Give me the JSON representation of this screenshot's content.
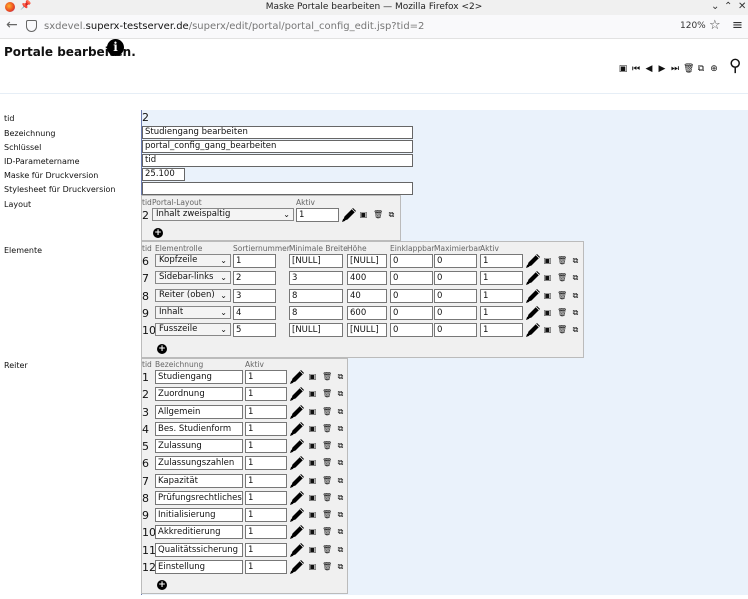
{
  "browser": {
    "window_title": "Maske Portale bearbeiten — Mozilla Firefox <2>",
    "url_prefix": "sxdevel.",
    "url_domain": "superx-testserver.de",
    "url_path": "/superx/edit/portal/portal_config_edit.jsp?tid=2",
    "zoom": "120%"
  },
  "page": {
    "title": "Portale bearbeiten.",
    "info_glyph": "i"
  },
  "toolbar": {
    "icons": [
      "save-icon",
      "first-icon",
      "prev-icon",
      "next-icon",
      "last-icon",
      "delete-icon",
      "copy-icon",
      "add-icon"
    ],
    "glyphs": [
      "▣",
      "⏮",
      "◀",
      "▶",
      "⏭",
      "🗑",
      "⧉",
      "⊕"
    ]
  },
  "form": {
    "tid_label": "tid",
    "tid_value": "2",
    "bezeichnung_label": "Bezeichnung",
    "bezeichnung_value": "Studiengang bearbeiten",
    "schluessel_label": "Schlüssel",
    "schluessel_value": "portal_config_gang_bearbeiten",
    "idparam_label": "ID-Parametername",
    "idparam_value": "tid",
    "maske_label": "Maske für Druckversion",
    "maske_value": "25.100",
    "stylesheet_label": "Stylesheet für Druckversion",
    "stylesheet_value": "",
    "layout_label": "Layout",
    "elemente_label": "Elemente",
    "reiter_label": "Reiter"
  },
  "layout_table": {
    "headers": {
      "tid": "tid",
      "layout": "Portal-Layout",
      "aktiv": "Aktiv"
    },
    "rows": [
      {
        "tid": "2",
        "layout": "Inhalt zweispaltig",
        "aktiv": "1"
      }
    ]
  },
  "elemente_table": {
    "headers": {
      "tid": "tid",
      "rolle": "Elementrolle",
      "sort": "Sortiernummer",
      "minbreite": "Minimale Breite",
      "hoehe": "Höhe",
      "einklapp": "Einklappbar",
      "maxim": "Maximierbar",
      "aktiv": "Aktiv"
    },
    "rows": [
      {
        "tid": "6",
        "rolle": "Kopfzeile",
        "sort": "1",
        "minbreite": "[NULL]",
        "hoehe": "[NULL]",
        "einklapp": "0",
        "maxim": "0",
        "aktiv": "1"
      },
      {
        "tid": "7",
        "rolle": "Sidebar-links",
        "sort": "2",
        "minbreite": "3",
        "hoehe": "400",
        "einklapp": "0",
        "maxim": "0",
        "aktiv": "1"
      },
      {
        "tid": "8",
        "rolle": "Reiter (oben)",
        "sort": "3",
        "minbreite": "8",
        "hoehe": "40",
        "einklapp": "0",
        "maxim": "0",
        "aktiv": "1"
      },
      {
        "tid": "9",
        "rolle": "Inhalt",
        "sort": "4",
        "minbreite": "8",
        "hoehe": "600",
        "einklapp": "0",
        "maxim": "0",
        "aktiv": "1"
      },
      {
        "tid": "10",
        "rolle": "Fusszeile",
        "sort": "5",
        "minbreite": "[NULL]",
        "hoehe": "[NULL]",
        "einklapp": "0",
        "maxim": "0",
        "aktiv": "1"
      }
    ]
  },
  "reiter_table": {
    "headers": {
      "tid": "tid",
      "bez": "Bezeichnung",
      "aktiv": "Aktiv"
    },
    "rows": [
      {
        "tid": "1",
        "bez": "Studiengang",
        "aktiv": "1"
      },
      {
        "tid": "2",
        "bez": "Zuordnung",
        "aktiv": "1"
      },
      {
        "tid": "3",
        "bez": "Allgemein",
        "aktiv": "1"
      },
      {
        "tid": "4",
        "bez": "Bes. Studienform",
        "aktiv": "1"
      },
      {
        "tid": "5",
        "bez": "Zulassung",
        "aktiv": "1"
      },
      {
        "tid": "6",
        "bez": "Zulassungszahlen",
        "aktiv": "1"
      },
      {
        "tid": "7",
        "bez": "Kapazität",
        "aktiv": "1"
      },
      {
        "tid": "8",
        "bez": "Prüfungsrechtliches",
        "aktiv": "1"
      },
      {
        "tid": "9",
        "bez": "Initialisierung",
        "aktiv": "1"
      },
      {
        "tid": "10",
        "bez": "Akkreditierung",
        "aktiv": "1"
      },
      {
        "tid": "11",
        "bez": "Qualitätssicherung",
        "aktiv": "1"
      },
      {
        "tid": "12",
        "bez": "Einstellung",
        "aktiv": "1"
      }
    ]
  },
  "row_icons": {
    "save": "▣",
    "delete": "🗑",
    "copy": "⧉",
    "add": "+",
    "dropdown": "⌄"
  }
}
